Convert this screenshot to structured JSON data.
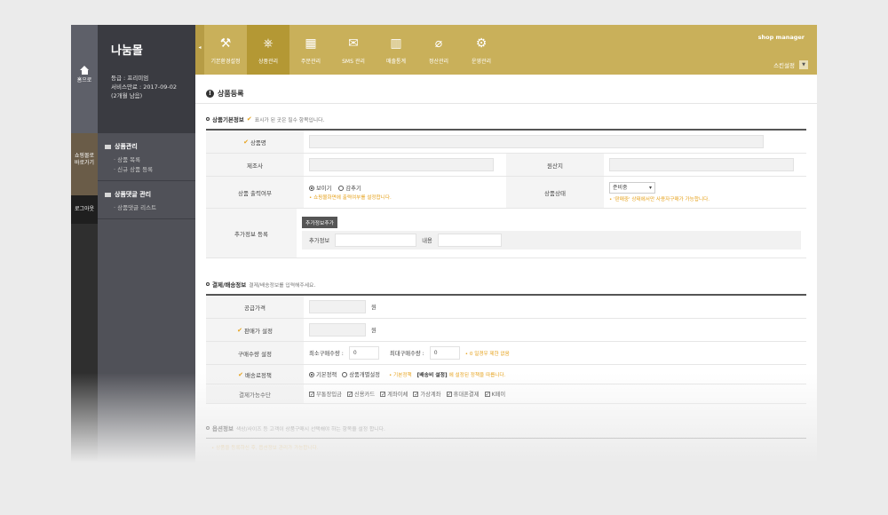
{
  "rail": {
    "home_label": "홈으로",
    "shop_label_1": "쇼핑몰로",
    "shop_label_2": "바로가기",
    "logout_label": "로그아웃"
  },
  "sidebar": {
    "shop_name": "나눔몰",
    "grade": "등급 : 프리미엄",
    "expiry": "서비스만료 : 2017-09-02",
    "remaining": "(2개월 남음)",
    "groups": [
      {
        "title": "상품관리",
        "items": [
          "상품 목록",
          "신규 상품 등록"
        ]
      },
      {
        "title": "상품댓글 관리",
        "items": [
          "상품댓글 리스트"
        ]
      }
    ]
  },
  "topnav": {
    "collapse": "◂",
    "items": [
      {
        "label": "기본환경설정",
        "icon": "tools-icon",
        "glyph": "⚒"
      },
      {
        "label": "상품관리",
        "icon": "helm-icon",
        "glyph": "⎈",
        "active": true
      },
      {
        "label": "주문관리",
        "icon": "binder-icon",
        "glyph": "▦"
      },
      {
        "label": "SMS 관리",
        "icon": "sms-icon",
        "glyph": "✉"
      },
      {
        "label": "매출통계",
        "icon": "bar-chart-icon",
        "glyph": "▥"
      },
      {
        "label": "정산관리",
        "icon": "paperclip-icon",
        "glyph": "⌀"
      },
      {
        "label": "운영관리",
        "icon": "wrench-icon",
        "glyph": "⚙"
      }
    ],
    "shop_manager": "shop manager",
    "skin_setting": "스킨설정"
  },
  "page": {
    "title": "상품등록",
    "basic_section": {
      "title": "상품기본정보",
      "hint": "표시가 된 곳은 필수 항목입니다.",
      "product_name_label": "상품명",
      "maker_label": "제조사",
      "origin_label": "원산지",
      "display_label": "상품 출력여부",
      "display_show": "보이기",
      "display_hide": "감추기",
      "display_note": "• 쇼핑몰화면에 출력여부를 설정합니다.",
      "status_label": "상품상태",
      "status_value": "준비중",
      "status_note": "• '판매중' 상태에서만 사용자구매가 가능합니다.",
      "extra_label": "추가정보 등록",
      "extra_button": "추가정보추가",
      "extra_field_label": "추가정보",
      "extra_content_label": "내용"
    },
    "payment_section": {
      "title": "결제/배송정보",
      "hint": "결제/배송정보를 입력해주세요.",
      "supply_price_label": "공급가격",
      "sale_price_label": "판매가 설정",
      "won": "원",
      "qty_label": "구매수량 설정",
      "min_qty_label": "최소구매수량 :",
      "min_qty_value": "0",
      "max_qty_label": "최대구매수량 :",
      "max_qty_value": "0",
      "qty_note": "• 0 일경우 제한 없음",
      "shipping_label": "배송료정책",
      "shipping_basic": "기본정책",
      "shipping_individual": "상품개별설정",
      "shipping_note_1": "• 기본정책",
      "shipping_note_2": "[배송비 설정]",
      "shipping_note_3": "에 설정된 정책을 따릅니다.",
      "payment_label": "결제가능수단",
      "payment_methods": [
        "무통장입금",
        "신용카드",
        "계좌이체",
        "가상계좌",
        "휴대폰결제",
        "K페이"
      ]
    },
    "option_section": {
      "title": "옵션정보",
      "hint": "색상/사이즈 등 고객이 상품구매시 선택해야 하는 항목을 설정 합니다.",
      "note": "• 상품을 등록하신 후, 옵션정보 관리가 가능합니다."
    }
  }
}
